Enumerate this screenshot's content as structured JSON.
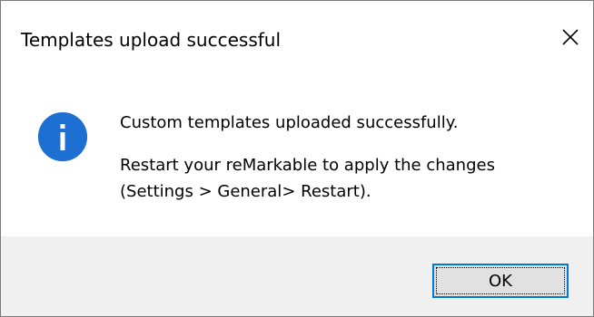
{
  "window": {
    "title": "Templates upload successful",
    "close_icon": "close-icon"
  },
  "message": {
    "icon": "info-icon",
    "line1": "Custom templates uploaded successfully.",
    "line2": "Restart your reMarkable to apply the changes",
    "line3": "(Settings > General> Restart)."
  },
  "buttons": {
    "ok_label": "OK"
  },
  "colors": {
    "info_icon": "#1d6fd1",
    "button_focus_border": "#0078d7",
    "footer_background": "#f0f0f0",
    "button_background": "#e1e1e1"
  }
}
